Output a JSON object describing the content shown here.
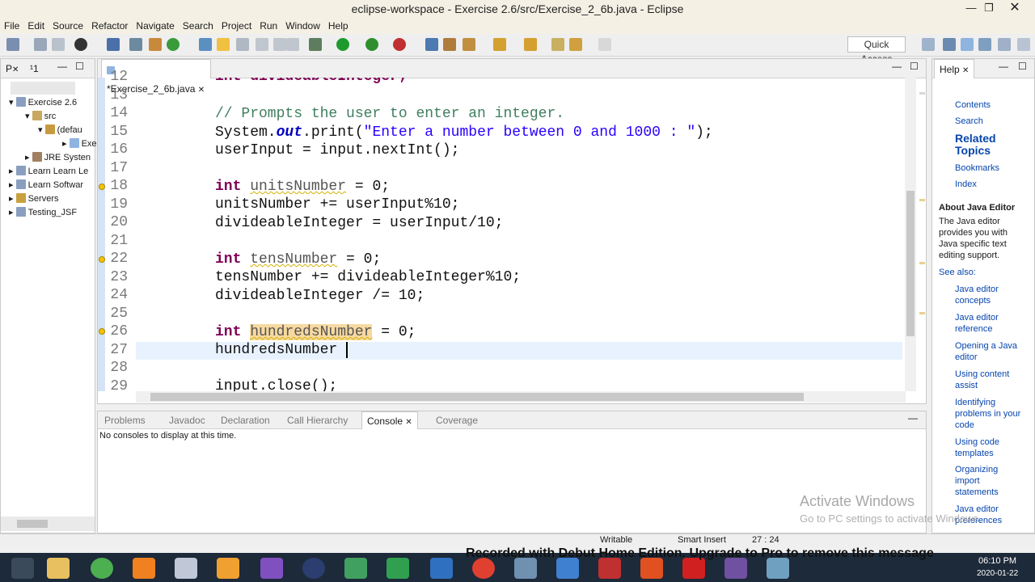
{
  "window": {
    "title": "eclipse-workspace - Exercise 2.6/src/Exercise_2_6b.java - Eclipse"
  },
  "menu": [
    "File",
    "Edit",
    "Source",
    "Refactor",
    "Navigate",
    "Search",
    "Project",
    "Run",
    "Window",
    "Help"
  ],
  "toolbar": {
    "quick_access": "Quick Access"
  },
  "package_explorer": {
    "tab_label": "P",
    "tab_count": "¹1",
    "items": [
      "Exercise 2.6",
      "src",
      "(defau",
      "Exe",
      "JRE Systen",
      "Learn Learn Le",
      "Learn Softwar",
      "Servers",
      "Testing_JSF"
    ]
  },
  "editor": {
    "tab_label": "*Exercise_2_6b.java",
    "line_numbers": [
      "12",
      "13",
      "14",
      "15",
      "16",
      "17",
      "18",
      "19",
      "20",
      "21",
      "22",
      "23",
      "24",
      "25",
      "26",
      "27",
      "28",
      "29"
    ],
    "lines": {
      "l12": "int divideableInteger;",
      "l14": "// Prompts the user to enter an integer.",
      "l15a": "System.",
      "l15b": "out",
      "l15c": ".print(",
      "l15d": "\"Enter a number between 0 and 1000 : \"",
      "l15e": ");",
      "l16": "userInput = input.nextInt();",
      "l18a": "int",
      "l18b": "unitsNumber",
      "l18c": " = 0;",
      "l19": "unitsNumber += userInput%10;",
      "l20": "divideableInteger = userInput/10;",
      "l22a": "int",
      "l22b": "tensNumber",
      "l22c": " = 0;",
      "l23": "tensNumber += divideableInteger%10;",
      "l24": "divideableInteger /= 10;",
      "l26a": "int",
      "l26b": "hundredsNumber",
      "l26c": " = 0;",
      "l27": "hundredsNumber ",
      "l29": "input.close();"
    }
  },
  "bottom_panel": {
    "tabs": [
      "Problems",
      "Javadoc",
      "Declaration",
      "Call Hierarchy",
      "Console",
      "Coverage"
    ],
    "message": "No consoles to display at this time."
  },
  "help": {
    "tab_label": "Help",
    "links": [
      "Contents",
      "Search",
      "Bookmarks",
      "Index"
    ],
    "related_topics": "Related Topics",
    "about_title": "About Java Editor",
    "about_text": "The Java editor provides you with Java specific text editing support.",
    "see_also": "See also:",
    "see_links": [
      "Java editor concepts",
      "Java editor reference",
      "Opening a Java editor",
      "Using content assist",
      "Identifying problems in your code",
      "Using code templates",
      "Organizing import statements",
      "Java editor preferences"
    ]
  },
  "status": {
    "writable": "Writable",
    "insert_mode": "Smart Insert",
    "position": "27 : 24"
  },
  "watermark": {
    "line1": "Activate Windows",
    "line2": "Go to PC settings to activate Windows."
  },
  "recorder": "Recorded with Debut Home Edition. Upgrade to Pro to remove this message",
  "taskbar": {
    "time": "06:10 PM",
    "date": "2020-01-22"
  },
  "colors": {
    "keyword": "#7f0055",
    "comment": "#3f7f5f",
    "string": "#2a00ff",
    "field": "#0000c0"
  }
}
